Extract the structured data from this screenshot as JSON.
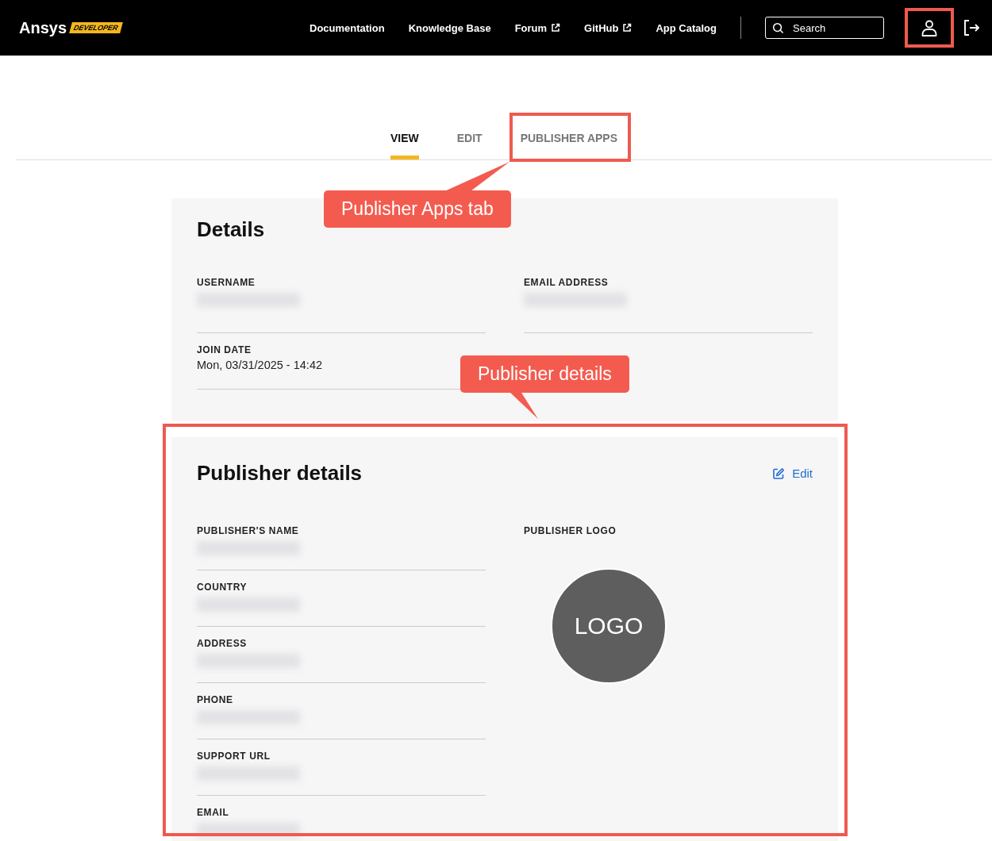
{
  "header": {
    "logo": {
      "brand": "Ansys",
      "badge": "DEVELOPER"
    },
    "nav": [
      {
        "label": "Documentation",
        "external": false
      },
      {
        "label": "Knowledge Base",
        "external": false
      },
      {
        "label": "Forum",
        "external": true
      },
      {
        "label": "GitHub",
        "external": true
      },
      {
        "label": "App Catalog",
        "external": false
      }
    ],
    "search": {
      "placeholder": "Search"
    }
  },
  "tabs": [
    {
      "label": "VIEW",
      "selected": true
    },
    {
      "label": "EDIT",
      "selected": false
    },
    {
      "label": "PUBLISHER APPS",
      "selected": false
    }
  ],
  "details": {
    "title": "Details",
    "fields": [
      {
        "label": "USERNAME",
        "blurred": true
      },
      {
        "label": "EMAIL ADDRESS",
        "blurred": true
      },
      {
        "label": "JOIN DATE",
        "value": "Mon, 03/31/2025 - 14:42",
        "blurred": false
      }
    ]
  },
  "publisher": {
    "title": "Publisher details",
    "edit_link": "Edit",
    "fields": [
      {
        "label": "PUBLISHER'S NAME",
        "blurred": true
      },
      {
        "label": "COUNTRY",
        "blurred": true
      },
      {
        "label": "ADDRESS",
        "blurred": true
      },
      {
        "label": "PHONE",
        "blurred": true
      },
      {
        "label": "SUPPORT URL",
        "blurred": true
      },
      {
        "label": "EMAIL",
        "blurred": true
      }
    ],
    "logo": {
      "label": "PUBLISHER LOGO",
      "placeholder_text": "LOGO"
    }
  },
  "annotations": [
    {
      "kind": "highlight"
    },
    {
      "kind": "highlight"
    },
    {
      "kind": "callout",
      "text": "Publisher Apps tab"
    },
    {
      "kind": "callout",
      "text": "Publisher details"
    },
    {
      "kind": "highlight"
    }
  ]
}
